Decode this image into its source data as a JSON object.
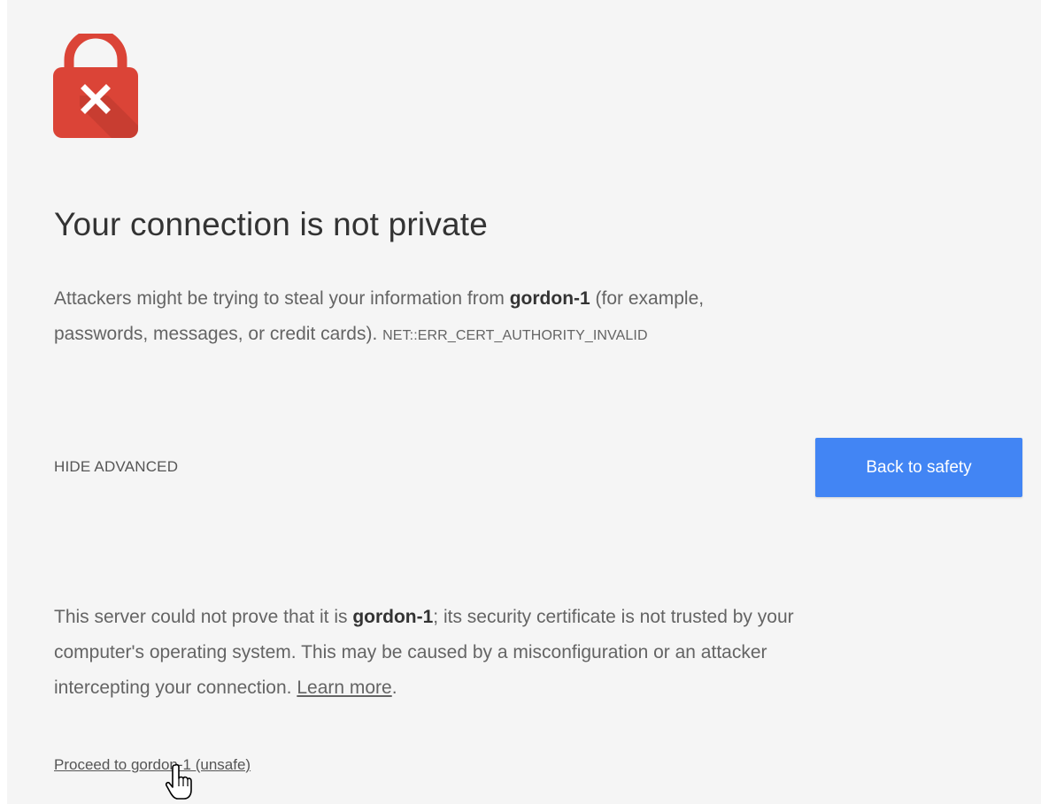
{
  "page": {
    "background": "#f5f5f5",
    "accent": "#4285f4",
    "danger": "#db4437"
  },
  "icon": {
    "name": "lock-error-icon"
  },
  "title": "Your connection is not private",
  "intro": {
    "prefix": "Attackers might be trying to steal your information from ",
    "host": "gordon-1",
    "suffix_line1": " (for example,",
    "line2": "passwords, messages, or credit cards). ",
    "error_code": "NET::ERR_CERT_AUTHORITY_INVALID"
  },
  "actions": {
    "hide_advanced": "HIDE ADVANCED",
    "back_to_safety": "Back to safety"
  },
  "details": {
    "prefix": "This server could not prove that it is ",
    "host": "gordon-1",
    "suffix_line1": "; its security certificate is not trusted by your",
    "line2": "computer's operating system. This may be caused by a misconfiguration or an attacker",
    "line3": "intercepting your connection. ",
    "learn_more": "Learn more",
    "end": "."
  },
  "proceed_link": "Proceed to gordon-1 (unsafe)",
  "cursor": {
    "name": "hand-pointer-icon"
  }
}
